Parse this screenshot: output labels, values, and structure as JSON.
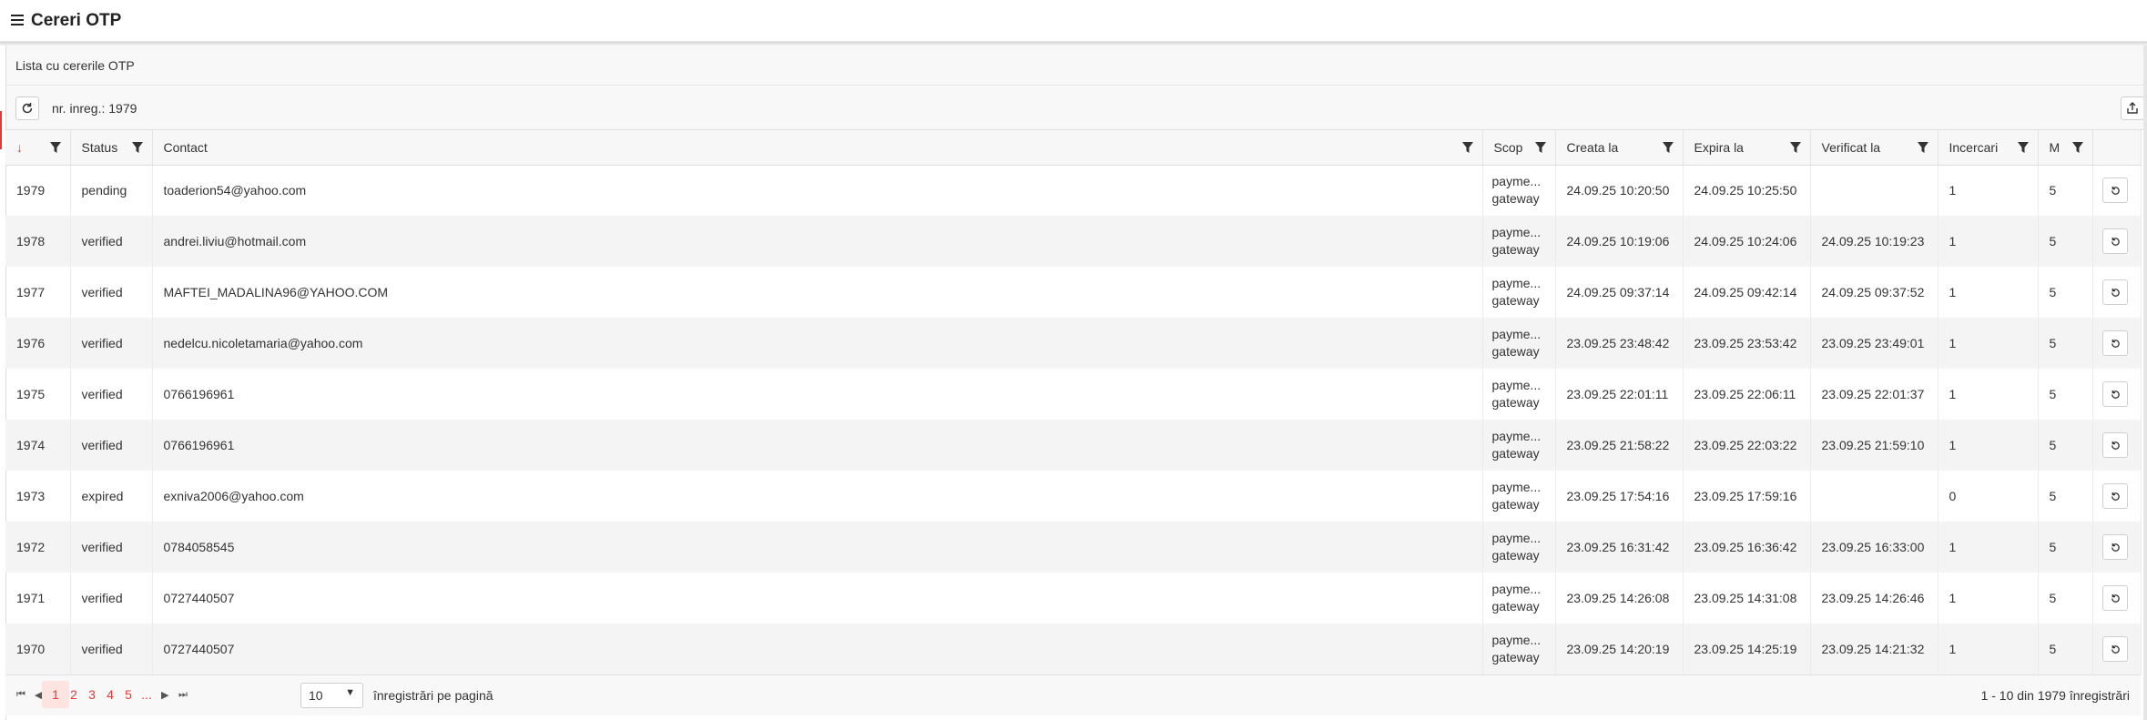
{
  "header": {
    "title": "Cereri OTP",
    "menu_icon": "hamburger-menu-icon"
  },
  "section": {
    "title": "Lista cu cererile OTP"
  },
  "toolbar": {
    "count_label": "nr. inreg.: 1979",
    "refresh_icon": "refresh-icon",
    "export_icon": "export-icon"
  },
  "columns": {
    "sort": "↓",
    "status": "Status",
    "contact": "Contact",
    "scope": "Scop",
    "created": "Creata la",
    "expires": "Expira la",
    "verified": "Verificat la",
    "attempts": "Incercari",
    "max": "M"
  },
  "rows": [
    {
      "id": "1979",
      "status": "pending",
      "contact": "toaderion54@yahoo.com",
      "scope1": "payme...",
      "scope2": "gateway",
      "created": "24.09.25 10:20:50",
      "expires": "24.09.25 10:25:50",
      "verified": "",
      "attempts": "1",
      "max": "5"
    },
    {
      "id": "1978",
      "status": "verified",
      "contact": "andrei.liviu@hotmail.com",
      "scope1": "payme...",
      "scope2": "gateway",
      "created": "24.09.25 10:19:06",
      "expires": "24.09.25 10:24:06",
      "verified": "24.09.25 10:19:23",
      "attempts": "1",
      "max": "5"
    },
    {
      "id": "1977",
      "status": "verified",
      "contact": "MAFTEI_MADALINA96@YAHOO.COM",
      "scope1": "payme...",
      "scope2": "gateway",
      "created": "24.09.25 09:37:14",
      "expires": "24.09.25 09:42:14",
      "verified": "24.09.25 09:37:52",
      "attempts": "1",
      "max": "5"
    },
    {
      "id": "1976",
      "status": "verified",
      "contact": "nedelcu.nicoletamaria@yahoo.com",
      "scope1": "payme...",
      "scope2": "gateway",
      "created": "23.09.25 23:48:42",
      "expires": "23.09.25 23:53:42",
      "verified": "23.09.25 23:49:01",
      "attempts": "1",
      "max": "5"
    },
    {
      "id": "1975",
      "status": "verified",
      "contact": "0766196961",
      "scope1": "payme...",
      "scope2": "gateway",
      "created": "23.09.25 22:01:11",
      "expires": "23.09.25 22:06:11",
      "verified": "23.09.25 22:01:37",
      "attempts": "1",
      "max": "5"
    },
    {
      "id": "1974",
      "status": "verified",
      "contact": "0766196961",
      "scope1": "payme...",
      "scope2": "gateway",
      "created": "23.09.25 21:58:22",
      "expires": "23.09.25 22:03:22",
      "verified": "23.09.25 21:59:10",
      "attempts": "1",
      "max": "5"
    },
    {
      "id": "1973",
      "status": "expired",
      "contact": "exniva2006@yahoo.com",
      "scope1": "payme...",
      "scope2": "gateway",
      "created": "23.09.25 17:54:16",
      "expires": "23.09.25 17:59:16",
      "verified": "",
      "attempts": "0",
      "max": "5"
    },
    {
      "id": "1972",
      "status": "verified",
      "contact": "0784058545",
      "scope1": "payme...",
      "scope2": "gateway",
      "created": "23.09.25 16:31:42",
      "expires": "23.09.25 16:36:42",
      "verified": "23.09.25 16:33:00",
      "attempts": "1",
      "max": "5"
    },
    {
      "id": "1971",
      "status": "verified",
      "contact": "0727440507",
      "scope1": "payme...",
      "scope2": "gateway",
      "created": "23.09.25 14:26:08",
      "expires": "23.09.25 14:31:08",
      "verified": "23.09.25 14:26:46",
      "attempts": "1",
      "max": "5"
    },
    {
      "id": "1970",
      "status": "verified",
      "contact": "0727440507",
      "scope1": "payme...",
      "scope2": "gateway",
      "created": "23.09.25 14:20:19",
      "expires": "23.09.25 14:25:19",
      "verified": "23.09.25 14:21:32",
      "attempts": "1",
      "max": "5"
    }
  ],
  "row_action_icon": "reset-icon",
  "pagination": {
    "pages": [
      "1",
      "2",
      "3",
      "4",
      "5",
      "..."
    ],
    "active_page": "1",
    "rows_per_page": "10",
    "rows_per_page_label": "înregistrări pe pagină",
    "range_label": "1 - 10 din 1979 înregistrări",
    "icons": [
      "first-page-icon",
      "prev-page-icon",
      "next-page-icon",
      "last-page-icon"
    ]
  },
  "colors": {
    "accent": "#e53935",
    "active_page_bg": "#fde4e1",
    "stripe": "#f4f4f4"
  }
}
